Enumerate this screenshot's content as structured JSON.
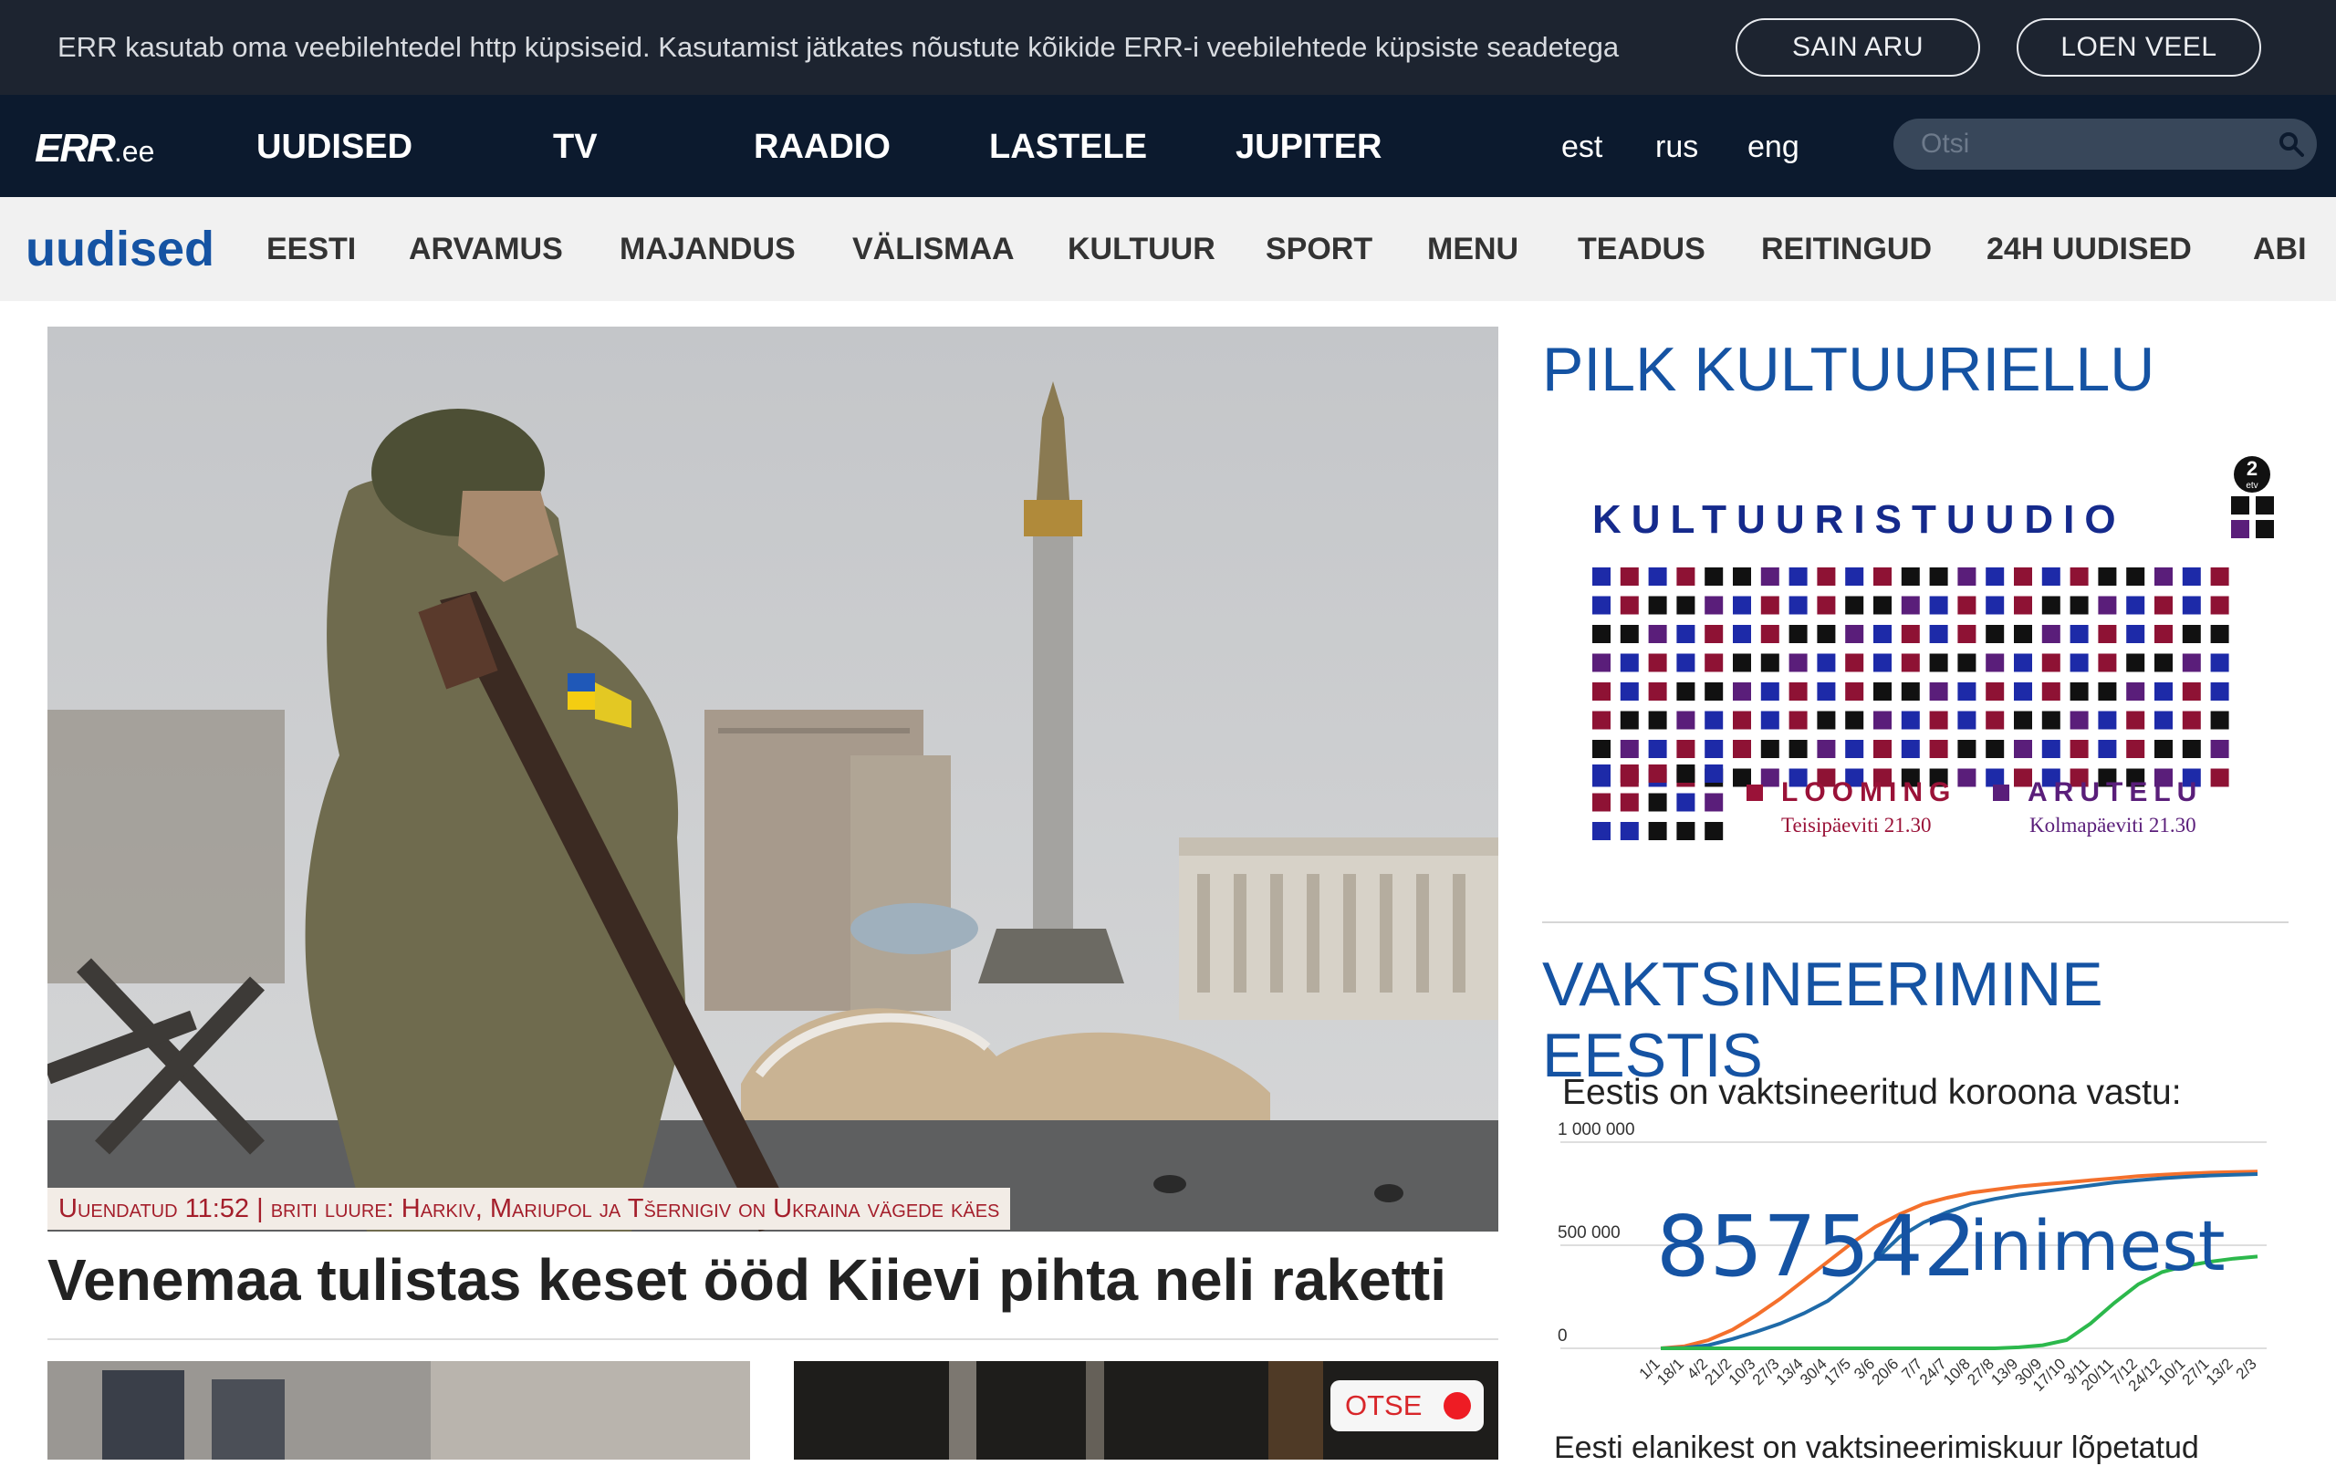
{
  "cookie": {
    "text": "ERR kasutab oma veebilehtedel http küpsiseid. Kasutamist jätkates nõustute kõikide ERR-i veebilehtede küpsiste seadetega",
    "accept_label": "SAIN ARU",
    "more_label": "LOEN VEEL"
  },
  "topnav": {
    "logo": "ERR",
    "logo_suffix": ".ee",
    "items": [
      "UUDISED",
      "TV",
      "RAADIO",
      "LASTELE",
      "JUPITER"
    ],
    "languages": [
      "est",
      "rus",
      "eng"
    ],
    "search_placeholder": "Otsi"
  },
  "secnav": {
    "logo": "uudised",
    "items": [
      "EESTI",
      "ARVAMUS",
      "MAJANDUS",
      "VÄLISMAA",
      "KULTUUR",
      "SPORT",
      "MENU",
      "TEADUS",
      "REITINGUD",
      "24H UUDISED",
      "ABI"
    ]
  },
  "hero": {
    "caption": "Uuendatud 11:52 | briti luure: Harkiv, Mariupol ja Tšernigiv on Ukraina vägede käes",
    "headline": "Venemaa tulistas keset ööd Kiievi pihta neli raketti",
    "live_label": "OTSE"
  },
  "side": {
    "culture_title": "PILK KULTUURIELLU",
    "promo": {
      "title": "KULTUURISTUUDIO",
      "channel": "2 etv",
      "left_label": "LOOMING",
      "left_time": "Teisipäeviti 21.30",
      "right_label": "ARUTELU",
      "right_time": "Kolmapäeviti 21.30"
    },
    "vax_title": "VAKTSINEERIMINE EESTIS",
    "vax_subtitle": "Eestis on vaktsineeritud koroona vastu:",
    "bottom_text": "Eesti elanikest on vaktsineerimiskuur lõpetatud"
  },
  "chart_data": {
    "type": "line",
    "title": "",
    "xlabel": "",
    "ylabel": "",
    "ylim": [
      0,
      1000000
    ],
    "y_ticks": [
      "1 000 000",
      "500 000",
      "0"
    ],
    "categories": [
      "1/1",
      "18/1",
      "4/2",
      "21/2",
      "10/3",
      "27/3",
      "13/4",
      "30/4",
      "17/5",
      "3/6",
      "20/6",
      "7/7",
      "24/7",
      "10/8",
      "27/8",
      "13/9",
      "30/9",
      "17/10",
      "3/11",
      "20/11",
      "7/12",
      "24/12",
      "10/1",
      "27/1",
      "13/2",
      "2/3"
    ],
    "overlay_value": "857542",
    "overlay_unit": "inimest",
    "series": [
      {
        "color": "#f4702c",
        "values": [
          0,
          10000,
          40000,
          90000,
          160000,
          240000,
          330000,
          420000,
          510000,
          590000,
          650000,
          700000,
          730000,
          755000,
          770000,
          785000,
          795000,
          805000,
          815000,
          825000,
          835000,
          842000,
          848000,
          852000,
          855000,
          857542
        ]
      },
      {
        "color": "#1f6aa8",
        "values": [
          0,
          2000,
          15000,
          45000,
          80000,
          120000,
          170000,
          230000,
          320000,
          430000,
          540000,
          610000,
          660000,
          700000,
          725000,
          745000,
          760000,
          775000,
          790000,
          805000,
          815000,
          825000,
          832000,
          838000,
          842000,
          845000
        ]
      },
      {
        "color": "#2cb84c",
        "values": [
          0,
          0,
          0,
          0,
          0,
          0,
          0,
          0,
          0,
          0,
          0,
          0,
          0,
          0,
          0,
          5000,
          15000,
          40000,
          120000,
          220000,
          310000,
          370000,
          400000,
          420000,
          435000,
          445000
        ]
      }
    ]
  }
}
